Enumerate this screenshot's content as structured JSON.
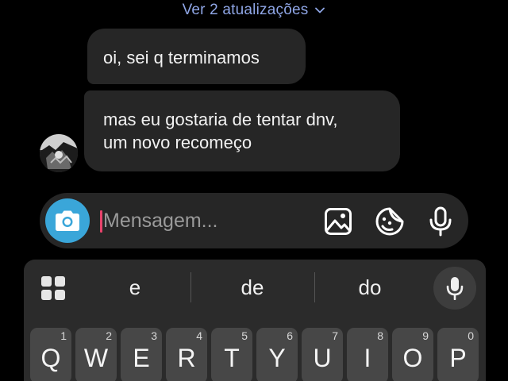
{
  "header": {
    "updates_label": "Ver 2 atualizações",
    "chevron_icon": "chevron-down-icon"
  },
  "messages": [
    {
      "lines": [
        "oi, sei q terminamos"
      ]
    },
    {
      "lines": [
        "mas eu gostaria de tentar dnv,",
        "um novo recomeço"
      ]
    }
  ],
  "composer": {
    "placeholder": "Mensagem...",
    "value": "",
    "icons": [
      "camera-icon",
      "gallery-icon",
      "sticker-icon",
      "microphone-icon"
    ],
    "camera_color": "#3aa6d9",
    "cursor_color": "#e8436b"
  },
  "keyboard": {
    "suggestions": [
      "e",
      "de",
      "do"
    ],
    "keys": [
      {
        "letter": "Q",
        "num": "1"
      },
      {
        "letter": "W",
        "num": "2"
      },
      {
        "letter": "E",
        "num": "3"
      },
      {
        "letter": "R",
        "num": "4"
      },
      {
        "letter": "T",
        "num": "5"
      },
      {
        "letter": "Y",
        "num": "6"
      },
      {
        "letter": "U",
        "num": "7"
      },
      {
        "letter": "I",
        "num": "8"
      },
      {
        "letter": "O",
        "num": "9"
      },
      {
        "letter": "P",
        "num": "0"
      }
    ]
  },
  "colors": {
    "background": "#000000",
    "bubble": "#262626",
    "link": "#8fa6e6",
    "keyboard": "#2b2b2b",
    "key": "#474747"
  }
}
